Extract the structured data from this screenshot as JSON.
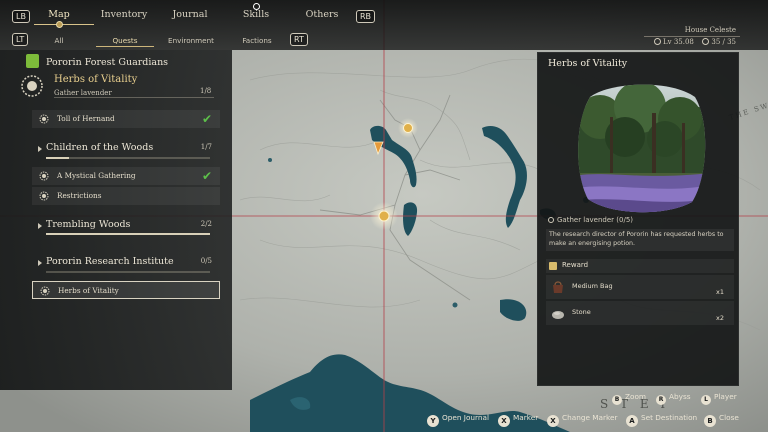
{
  "top_nav": {
    "lb": "LB",
    "rb": "RB",
    "skill_badge": "0",
    "tabs": [
      {
        "label": "Map",
        "active": true
      },
      {
        "label": "Inventory",
        "active": false
      },
      {
        "label": "Journal",
        "active": false
      },
      {
        "label": "Skills",
        "active": false
      },
      {
        "label": "Others",
        "active": false
      }
    ]
  },
  "sub_nav": {
    "lt": "LT",
    "rt": "RT",
    "tabs": [
      {
        "label": "All",
        "active": false
      },
      {
        "label": "Quests",
        "active": true
      },
      {
        "label": "Environment",
        "active": false
      },
      {
        "label": "Factions",
        "active": false
      }
    ]
  },
  "location": {
    "name": "House Celeste",
    "level": "Lv 35.08",
    "count": "35 / 35"
  },
  "quest_log": {
    "group_title": "Pororin Forest Guardians",
    "tracked": {
      "title": "Herbs of Vitality",
      "objective": "Gather lavender",
      "progress": "1/8"
    },
    "categories": [
      {
        "title": "Children of the Woods",
        "progress": "1/7",
        "progress_fraction": 0.14,
        "quests": [
          {
            "label": "A Mystical Gathering",
            "completed": true
          },
          {
            "label": "Restrictions",
            "completed": false
          }
        ]
      },
      {
        "title": "Trembling Woods",
        "progress": "2/2",
        "progress_fraction": 1.0,
        "quests": []
      },
      {
        "title": "Pororin Research Institute",
        "progress": "0/5",
        "progress_fraction": 0.0,
        "quests": [
          {
            "label": "Herbs of Vitality",
            "completed": false,
            "selected": true
          }
        ]
      }
    ],
    "standalone_quests": [
      {
        "label": "Toll of Hernand",
        "completed": true
      }
    ]
  },
  "detail": {
    "title": "Herbs of Vitality",
    "objective": "Gather lavender (0/5)",
    "description": "The research director of Pororin has requested herbs to make an energising potion.",
    "reward_label": "Reward",
    "rewards": [
      {
        "name": "Medium Bag",
        "qty": "x1"
      },
      {
        "name": "Stone",
        "qty": "x2"
      }
    ]
  },
  "hints": {
    "zoom": {
      "key": "B",
      "label": "Zoom"
    },
    "abyss": {
      "key": "R",
      "label": "Abyss"
    },
    "player": {
      "key": "L",
      "label": "Player"
    },
    "journal": {
      "key": "Y",
      "label": "Open Journal"
    },
    "marker": {
      "key": "X",
      "label": "Marker"
    },
    "change_marker": {
      "key": "X",
      "label": "Change Marker"
    },
    "destination": {
      "key": "A",
      "label": "Set Destination"
    },
    "close": {
      "key": "B",
      "label": "Close"
    }
  },
  "map": {
    "labels": {
      "top_right": "THE SWARD",
      "bottom_right": "S T E I"
    },
    "colors": {
      "land": "#b9bcb6",
      "water": "#1f4f5c",
      "crosshair": "#b3404a",
      "marker": "#e0b04a"
    }
  }
}
